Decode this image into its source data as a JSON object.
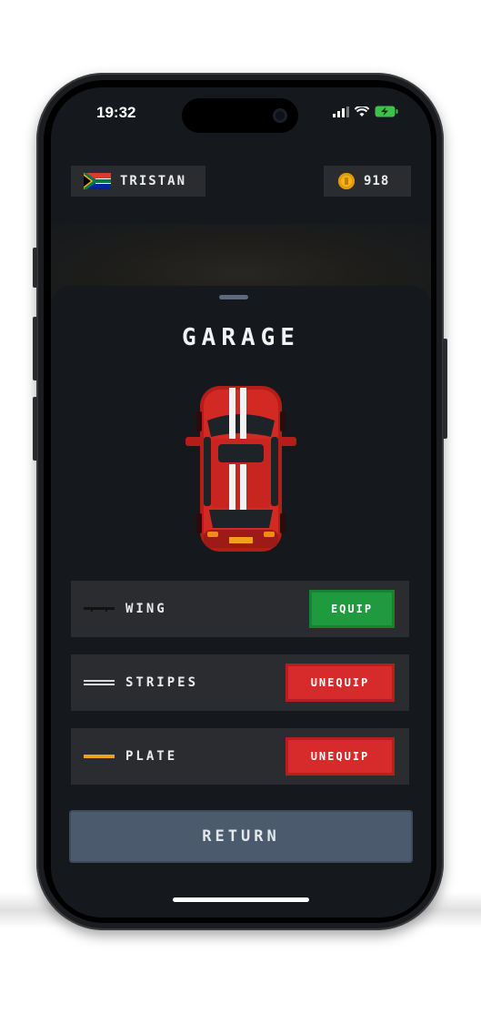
{
  "status": {
    "time": "19:32"
  },
  "header": {
    "username": "TRISTAN",
    "coins": "918"
  },
  "garage": {
    "title": "GARAGE",
    "items": [
      {
        "label": "WING",
        "action": "EQUIP",
        "icon": "wing-icon",
        "color": "#1f1f1f"
      },
      {
        "label": "STRIPES",
        "action": "UNEQUIP",
        "icon": "stripes-icon",
        "color": "#d9d9d9"
      },
      {
        "label": "PLATE",
        "action": "UNEQUIP",
        "icon": "plate-icon",
        "color": "#f0a020"
      }
    ],
    "return_label": "RETURN"
  },
  "colors": {
    "equip": "#1f9a3e",
    "unequip": "#d72a2a",
    "return": "#4b5b6d",
    "background": "#15181c",
    "car": "#d22a22"
  }
}
